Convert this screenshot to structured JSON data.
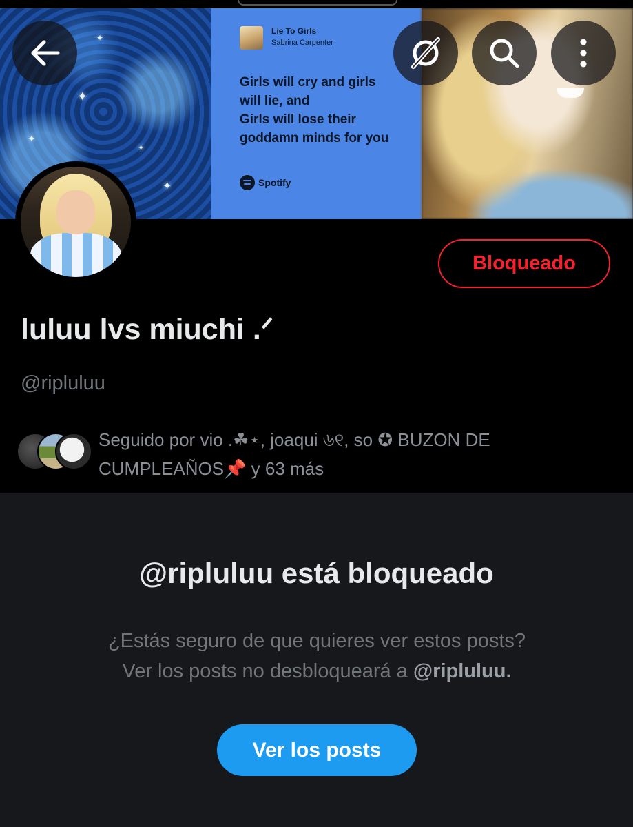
{
  "banner": {
    "song_title": "Lie To Girls",
    "song_artist": "Sabrina Carpenter",
    "lyrics": "Girls will cry and girls\nwill lie, and\nGirls will lose their\ngoddamn minds for you",
    "spotify_label": "Spotify"
  },
  "toolbar": {
    "back_icon": "arrow-left-icon",
    "grok_icon": "grok-icon",
    "search_icon": "search-icon",
    "more_icon": "more-vertical-icon"
  },
  "profile": {
    "display_name": "luluu lvs miuchi .ᐟ",
    "handle": "@ripluluu",
    "blocked_button_label": "Bloqueado",
    "followed_by": "Seguido por vio .☘︎⋆, joaqui ৬୧, so ✪ BUZON DE CUMPLEAÑOS📌 y 63 más"
  },
  "blocked": {
    "title": "@ripluluu está bloqueado",
    "message_line1": "¿Estás seguro de que quieres ver estos posts?",
    "message_line2_prefix": "Ver los posts no desbloqueará a ",
    "message_line2_handle": "@ripluluu.",
    "view_button_label": "Ver los posts"
  },
  "colors": {
    "blocked_red": "#f4212e",
    "button_blue": "#1d9bf0",
    "muted_text": "#71767b"
  }
}
